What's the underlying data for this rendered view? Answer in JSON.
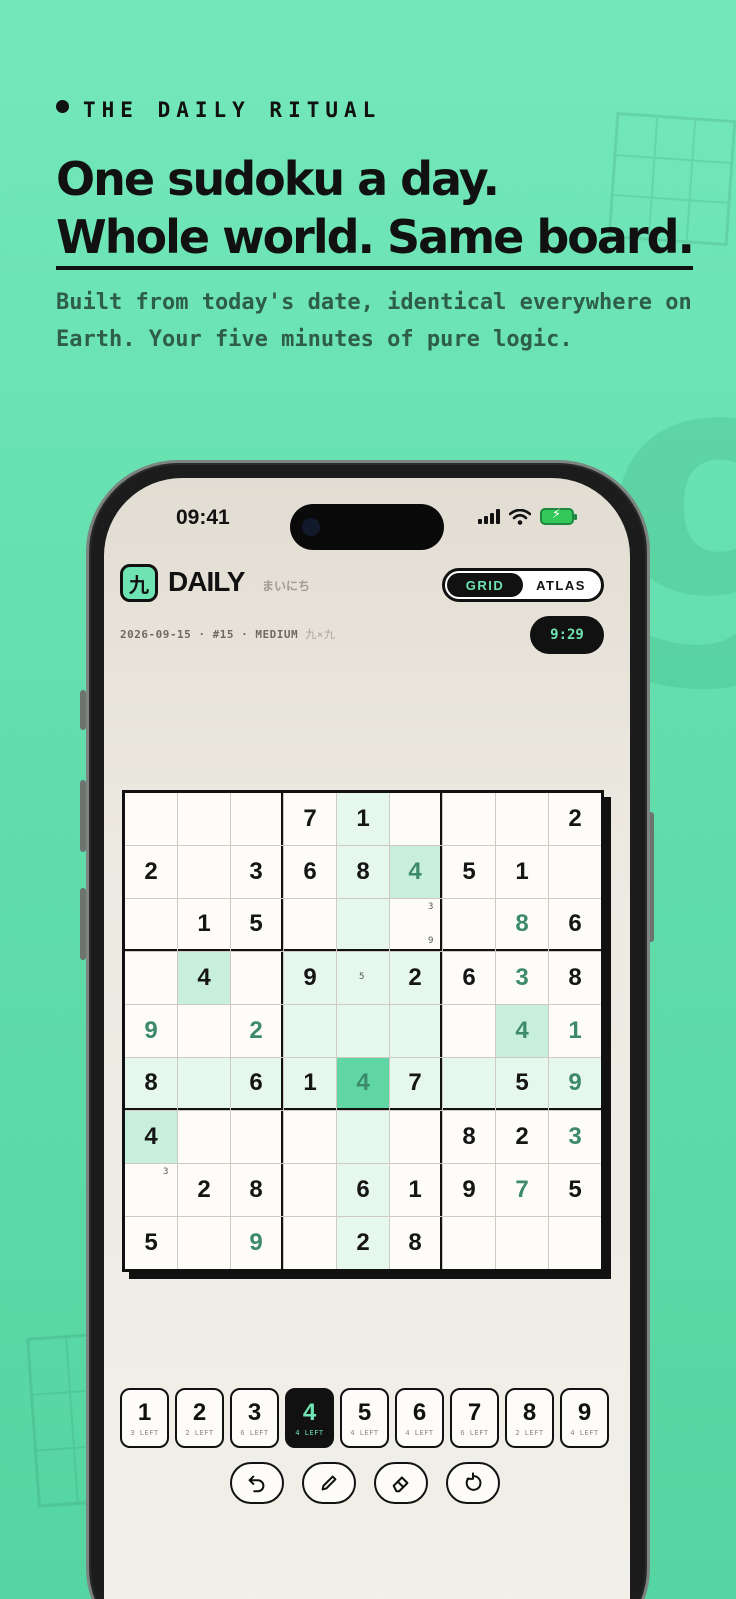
{
  "hero": {
    "eyebrow": "THE DAILY RITUAL",
    "headline_line1": "One sudoku a day.",
    "headline_line2": "Whole world. Same board.",
    "subtitle": "Built from today's date, identical everywhere on Earth. Your five minutes of pure logic.",
    "background_digit": "9"
  },
  "status_bar": {
    "time": "09:41"
  },
  "app": {
    "logo_char": "九",
    "title": "DAILY",
    "title_jp": "まいにち",
    "view_toggle": {
      "options": [
        "GRID",
        "ATLAS"
      ],
      "selected": "GRID"
    },
    "meta": "2026-09-15 · #15 · MEDIUM",
    "meta_kanji": "九×九",
    "timer": "9:29"
  },
  "board": {
    "rows": [
      [
        "",
        "",
        "",
        "7",
        "1",
        "",
        "",
        "",
        "2"
      ],
      [
        "2",
        "",
        "3",
        "6",
        "8",
        "4",
        "5",
        "1",
        ""
      ],
      [
        "",
        "1",
        "5",
        "",
        "",
        "",
        "",
        "8",
        "6"
      ],
      [
        "",
        "4",
        "",
        "9",
        "",
        "2",
        "6",
        "3",
        "8"
      ],
      [
        "9",
        "",
        "2",
        "",
        "",
        "",
        "",
        "4",
        "1"
      ],
      [
        "8",
        "",
        "6",
        "1",
        "4",
        "7",
        "",
        "5",
        "9"
      ],
      [
        "4",
        "",
        "",
        "",
        "",
        "",
        "8",
        "2",
        "3"
      ],
      [
        "",
        "2",
        "8",
        "",
        "6",
        "1",
        "9",
        "7",
        "5"
      ],
      [
        "5",
        "",
        "9",
        "",
        "2",
        "8",
        "",
        "",
        ""
      ]
    ],
    "user_entered": [
      [
        1,
        5
      ],
      [
        2,
        7
      ],
      [
        3,
        7
      ],
      [
        4,
        0
      ],
      [
        4,
        2
      ],
      [
        4,
        7
      ],
      [
        4,
        8
      ],
      [
        5,
        4
      ],
      [
        5,
        8
      ],
      [
        6,
        8
      ],
      [
        7,
        7
      ],
      [
        8,
        2
      ]
    ],
    "selected_cell": [
      5,
      4
    ],
    "same_number_cells": [
      [
        1,
        5
      ],
      [
        3,
        1
      ],
      [
        4,
        7
      ],
      [
        6,
        0
      ]
    ],
    "notes": [
      {
        "cell": [
          2,
          5
        ],
        "digits": [
          "3",
          "9"
        ]
      },
      {
        "cell": [
          3,
          4
        ],
        "digits": [
          "5"
        ]
      },
      {
        "cell": [
          7,
          0
        ],
        "digits": [
          "3"
        ]
      }
    ]
  },
  "numpad": [
    {
      "digit": "1",
      "left": "3 LEFT"
    },
    {
      "digit": "2",
      "left": "2 LEFT"
    },
    {
      "digit": "3",
      "left": "6 LEFT"
    },
    {
      "digit": "4",
      "left": "4 LEFT",
      "active": true
    },
    {
      "digit": "5",
      "left": "4 LEFT"
    },
    {
      "digit": "6",
      "left": "4 LEFT"
    },
    {
      "digit": "7",
      "left": "6 LEFT"
    },
    {
      "digit": "8",
      "left": "2 LEFT"
    },
    {
      "digit": "9",
      "left": "4 LEFT"
    }
  ],
  "tools": [
    "undo-icon",
    "pencil-icon",
    "eraser-icon",
    "restart-icon"
  ],
  "colors": {
    "mint": "#6ee4b3",
    "ink": "#111111",
    "user_digit": "#3d8a6a"
  }
}
